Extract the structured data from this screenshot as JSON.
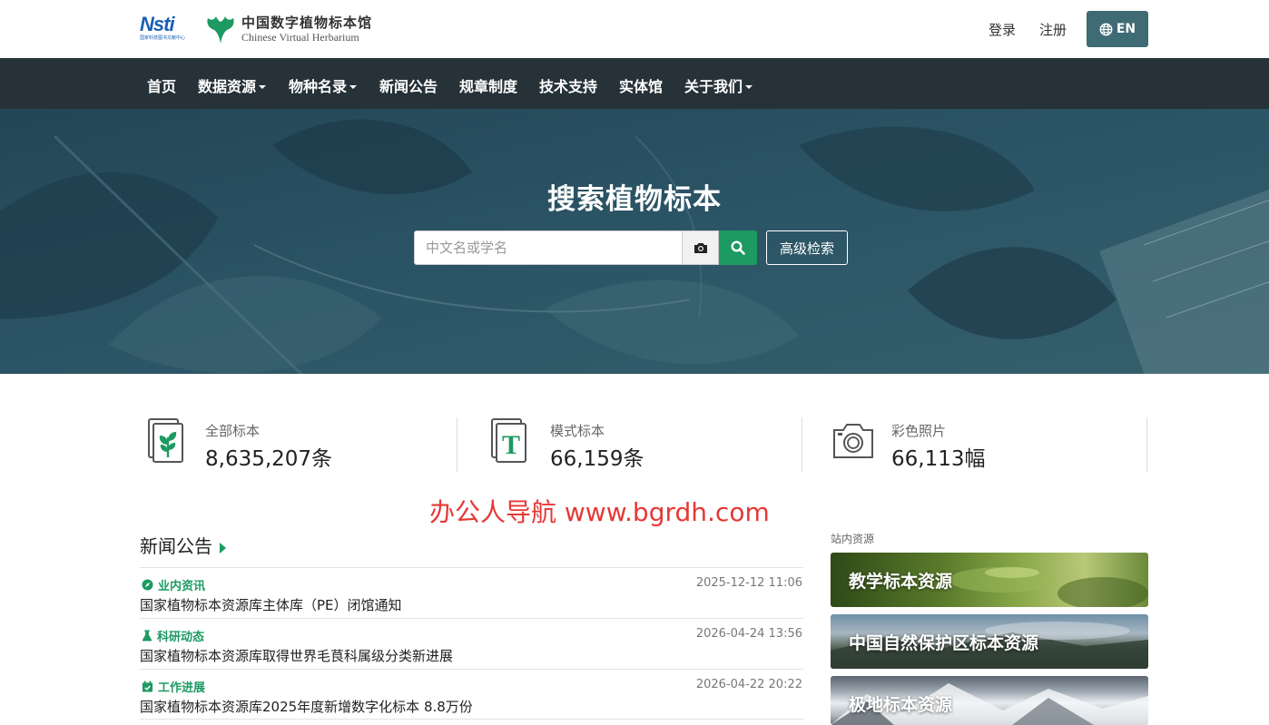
{
  "header": {
    "nstl_logo_text": "Nsti",
    "nstl_logo_sub": "国家科技图书文献中心",
    "site_title_cn": "中国数字植物标本馆",
    "site_title_en": "Chinese Virtual Herbarium",
    "login_label": "登录",
    "register_label": "注册",
    "lang_label": "EN"
  },
  "nav": {
    "items": [
      {
        "label": "首页",
        "dropdown": false
      },
      {
        "label": "数据资源",
        "dropdown": true
      },
      {
        "label": "物种名录",
        "dropdown": true
      },
      {
        "label": "新闻公告",
        "dropdown": false
      },
      {
        "label": "规章制度",
        "dropdown": false
      },
      {
        "label": "技术支持",
        "dropdown": false
      },
      {
        "label": "实体馆",
        "dropdown": false
      },
      {
        "label": "关于我们",
        "dropdown": true
      }
    ]
  },
  "hero": {
    "title": "搜索植物标本",
    "search_placeholder": "中文名或学名",
    "advanced_search_label": "高级检索"
  },
  "stats": [
    {
      "label": "全部标本",
      "value": "8,635,207条",
      "icon": "plant-icon"
    },
    {
      "label": "模式标本",
      "value": "66,159条",
      "icon": "type-specimen-icon"
    },
    {
      "label": "彩色照片",
      "value": "66,113幅",
      "icon": "camera-icon"
    }
  ],
  "watermark": "办公人导航 www.bgrdh.com",
  "news": {
    "title": "新闻公告",
    "items": [
      {
        "category": "业内资讯",
        "icon": "compass-icon",
        "date": "2025-12-12 11:06",
        "title": "国家植物标本资源库主体库（PE）闭馆通知"
      },
      {
        "category": "科研动态",
        "icon": "flask-icon",
        "date": "2026-04-24 13:56",
        "title": "国家植物标本资源库取得世界毛茛科属级分类新进展"
      },
      {
        "category": "工作进展",
        "icon": "calendar-check-icon",
        "date": "2026-04-22 20:22",
        "title": "国家植物标本资源库2025年度新增数字化标本 8.8万份"
      }
    ]
  },
  "resources": {
    "label": "站内资源",
    "items": [
      {
        "label": "教学标本资源"
      },
      {
        "label": "中国自然保护区标本资源"
      },
      {
        "label": "极地标本资源"
      }
    ]
  },
  "colors": {
    "nav_bg": "#263238",
    "hero_bg": "#29515f",
    "accent_green": "#1d9a62",
    "lang_btn": "#3e6b74",
    "watermark_red": "#e53935"
  }
}
